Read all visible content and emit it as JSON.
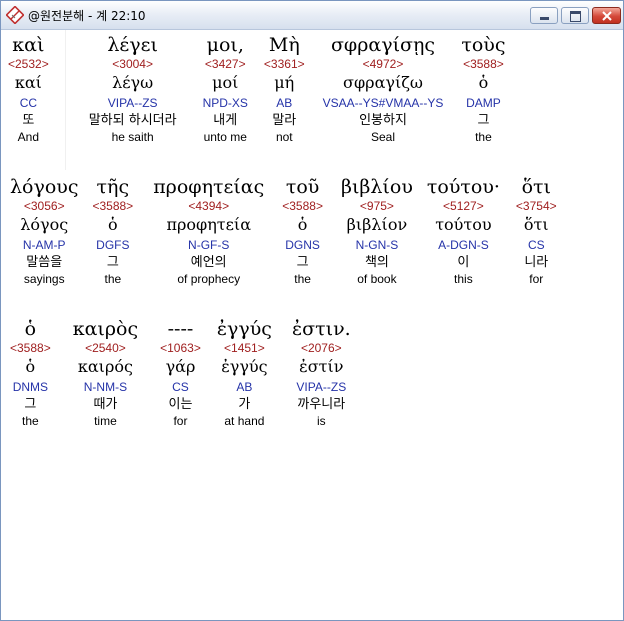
{
  "window": {
    "title": "@원전분해 - 계 22:10",
    "icon": "diamond-app-icon",
    "controls": {
      "minimize": "minimize-icon",
      "maximize": "maximize-icon",
      "close": "close-icon"
    },
    "accent": "#d4493a"
  },
  "colors": {
    "strongs": "#a02020",
    "parsing": "#2533a8",
    "text": "#000000"
  },
  "rows": [
    [
      {
        "greek": "καὶ",
        "strongs": "<2532>",
        "lemma": "καί",
        "parsing": "CC",
        "korean": "또",
        "english": "And"
      },
      {
        "greek": "λέγει",
        "strongs": "<3004>",
        "lemma": "λέγω",
        "parsing": "VIPA--ZS",
        "korean": "말하되 하시더라",
        "english": "he saith"
      },
      {
        "greek": "μοι,",
        "strongs": "<3427>",
        "lemma": "μοί",
        "parsing": "NPD-XS",
        "korean": "내게",
        "english": "unto me"
      },
      {
        "greek": "Μὴ",
        "strongs": "<3361>",
        "lemma": "μή",
        "parsing": "AB",
        "korean": "말라",
        "english": "not"
      },
      {
        "greek": "σφραγίσῃς",
        "strongs": "<4972>",
        "lemma": "σφραγίζω",
        "parsing": "VSAA--YS#VMAA--YS",
        "korean": "인봉하지",
        "english": "Seal"
      },
      {
        "greek": "τοὺς",
        "strongs": "<3588>",
        "lemma": "ὁ",
        "parsing": "DAMP",
        "korean": "그",
        "english": "the"
      }
    ],
    [
      {
        "greek": "λόγους",
        "strongs": "<3056>",
        "lemma": "λόγος",
        "parsing": "N-AM-P",
        "korean": "말씀을",
        "english": "sayings"
      },
      {
        "greek": "τῆς",
        "strongs": "<3588>",
        "lemma": "ὁ",
        "parsing": "DGFS",
        "korean": "그",
        "english": "the"
      },
      {
        "greek": "προφητείας",
        "strongs": "<4394>",
        "lemma": "προφητεία",
        "parsing": "N-GF-S",
        "korean": "예언의",
        "english": "of prophecy"
      },
      {
        "greek": "τοῦ",
        "strongs": "<3588>",
        "lemma": "ὁ",
        "parsing": "DGNS",
        "korean": "그",
        "english": "the"
      },
      {
        "greek": "βιβλίου",
        "strongs": "<975>",
        "lemma": "βιβλίον",
        "parsing": "N-GN-S",
        "korean": "책의",
        "english": "of book"
      },
      {
        "greek": "τούτου·",
        "strongs": "<5127>",
        "lemma": "τούτου",
        "parsing": "A-DGN-S",
        "korean": "이",
        "english": "this"
      },
      {
        "greek": "ὅτι",
        "strongs": "<3754>",
        "lemma": "ὅτι",
        "parsing": "CS",
        "korean": "니라",
        "english": "for"
      }
    ],
    [
      {
        "greek": "ὁ",
        "strongs": "<3588>",
        "lemma": "ὁ",
        "parsing": "DNMS",
        "korean": "그",
        "english": "the"
      },
      {
        "greek": "καιρὸς",
        "strongs": "<2540>",
        "lemma": "καιρός",
        "parsing": "N-NM-S",
        "korean": "때가",
        "english": "time"
      },
      {
        "greek": "----",
        "strongs": "<1063>",
        "lemma": "γάρ",
        "parsing": "CS",
        "korean": "이는",
        "english": "for"
      },
      {
        "greek": "ἐγγύς",
        "strongs": "<1451>",
        "lemma": "ἐγγύς",
        "parsing": "AB",
        "korean": "가",
        "english": "at hand"
      },
      {
        "greek": "ἐστιν.",
        "strongs": "<2076>",
        "lemma": "ἐστίν",
        "parsing": "VIPA--ZS",
        "korean": "까우니라",
        "english": "is"
      }
    ]
  ]
}
